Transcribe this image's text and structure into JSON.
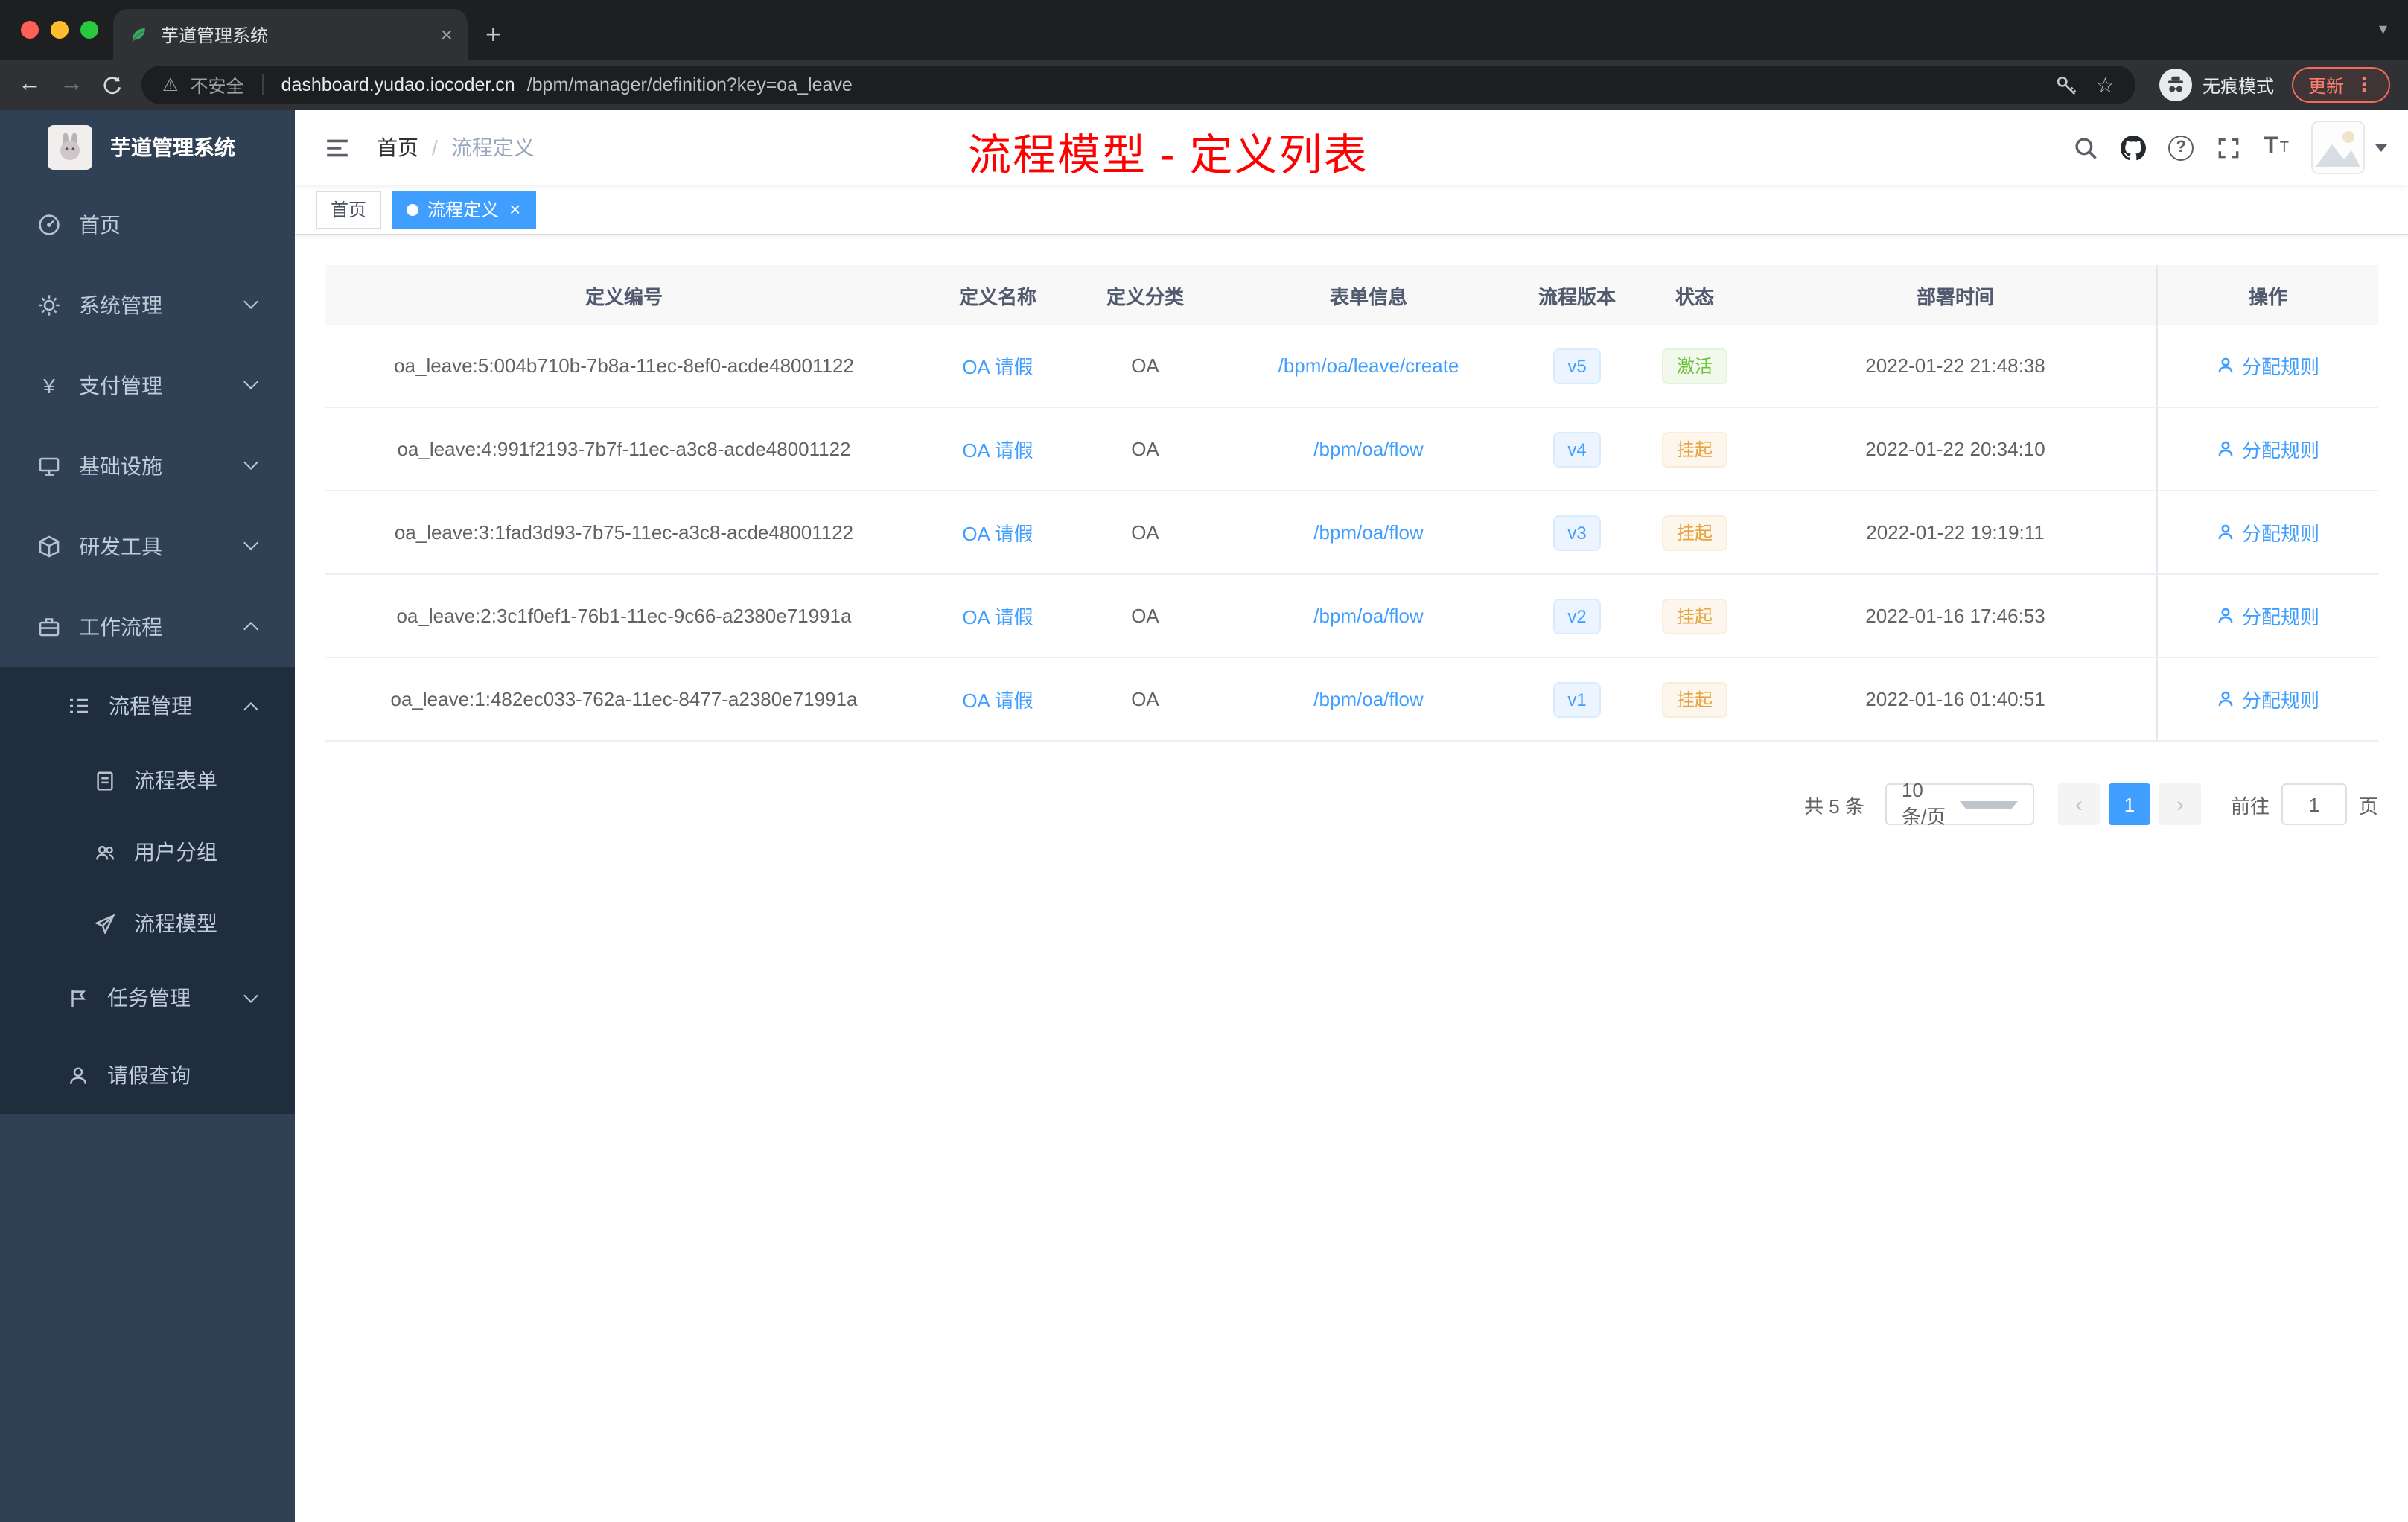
{
  "browser": {
    "tab_title": "芋道管理系统",
    "new_tab_button": "+",
    "security_label": "不安全",
    "url_domain": "dashboard.yudao.iocoder.cn",
    "url_path": "/bpm/manager/definition?key=oa_leave",
    "incognito_label": "无痕模式",
    "update_label": "更新"
  },
  "sidebar": {
    "logo_title": "芋道管理系统",
    "items": [
      {
        "label": "首页"
      },
      {
        "label": "系统管理"
      },
      {
        "label": "支付管理"
      },
      {
        "label": "基础设施"
      },
      {
        "label": "研发工具"
      },
      {
        "label": "工作流程"
      },
      {
        "label": "流程管理"
      },
      {
        "label": "流程表单"
      },
      {
        "label": "用户分组"
      },
      {
        "label": "流程模型"
      },
      {
        "label": "任务管理"
      },
      {
        "label": "请假查询"
      }
    ]
  },
  "navbar": {
    "breadcrumb": [
      "首页",
      "流程定义"
    ],
    "breadcrumb_separator": "/",
    "annotation": "流程模型 - 定义列表"
  },
  "tags": [
    {
      "label": "首页",
      "active": false
    },
    {
      "label": "流程定义",
      "active": true
    }
  ],
  "table": {
    "headers": [
      "定义编号",
      "定义名称",
      "定义分类",
      "表单信息",
      "流程版本",
      "状态",
      "部署时间",
      "操作"
    ],
    "rows": [
      {
        "id": "oa_leave:5:004b710b-7b8a-11ec-8ef0-acde48001122",
        "name": "OA 请假",
        "category": "OA",
        "form": "/bpm/oa/leave/create",
        "version": "v5",
        "status": "激活",
        "status_type": "success",
        "time": "2022-01-22 21:48:38",
        "action": "分配规则"
      },
      {
        "id": "oa_leave:4:991f2193-7b7f-11ec-a3c8-acde48001122",
        "name": "OA 请假",
        "category": "OA",
        "form": "/bpm/oa/flow",
        "version": "v4",
        "status": "挂起",
        "status_type": "warning",
        "time": "2022-01-22 20:34:10",
        "action": "分配规则"
      },
      {
        "id": "oa_leave:3:1fad3d93-7b75-11ec-a3c8-acde48001122",
        "name": "OA 请假",
        "category": "OA",
        "form": "/bpm/oa/flow",
        "version": "v3",
        "status": "挂起",
        "status_type": "warning",
        "time": "2022-01-22 19:19:11",
        "action": "分配规则"
      },
      {
        "id": "oa_leave:2:3c1f0ef1-76b1-11ec-9c66-a2380e71991a",
        "name": "OA 请假",
        "category": "OA",
        "form": "/bpm/oa/flow",
        "version": "v2",
        "status": "挂起",
        "status_type": "warning",
        "time": "2022-01-16 17:46:53",
        "action": "分配规则"
      },
      {
        "id": "oa_leave:1:482ec033-762a-11ec-8477-a2380e71991a",
        "name": "OA 请假",
        "category": "OA",
        "form": "/bpm/oa/flow",
        "version": "v1",
        "status": "挂起",
        "status_type": "warning",
        "time": "2022-01-16 01:40:51",
        "action": "分配规则"
      }
    ]
  },
  "pagination": {
    "total": "共 5 条",
    "page_size": "10条/页",
    "prev": "‹",
    "current": "1",
    "next": "›",
    "goto": "前往",
    "goto_value": "1",
    "page_unit": "页"
  },
  "icons": {
    "tab_favicon": "leaf-icon",
    "security": "warning-triangle-icon",
    "omnibox_right": [
      "key-icon",
      "star-icon"
    ],
    "incognito": "spy-icon",
    "browser_menu": "kebab-dots-icon",
    "sidebar": [
      "dashboard-icon",
      "gear-icon",
      "yen-icon",
      "monitor-icon",
      "cube-icon",
      "briefcase-icon",
      "list-icon",
      "document-icon",
      "people-icon",
      "paper-plane-icon",
      "flag-icon",
      "person-icon"
    ],
    "navbar_right": [
      "search-icon",
      "github-icon",
      "question-icon",
      "fullscreen-icon",
      "font-size-icon",
      "avatar",
      "caret-down-icon"
    ],
    "table_action": "person-icon"
  },
  "colors": {
    "accent": "#409eff",
    "status_active": "#67c23a",
    "status_suspended": "#e6a23c",
    "annotation_red": "#ff0000",
    "sidebar_bg": "#304156",
    "submenu_bg": "#1f2d3d",
    "update_pill": "#f4695c"
  }
}
